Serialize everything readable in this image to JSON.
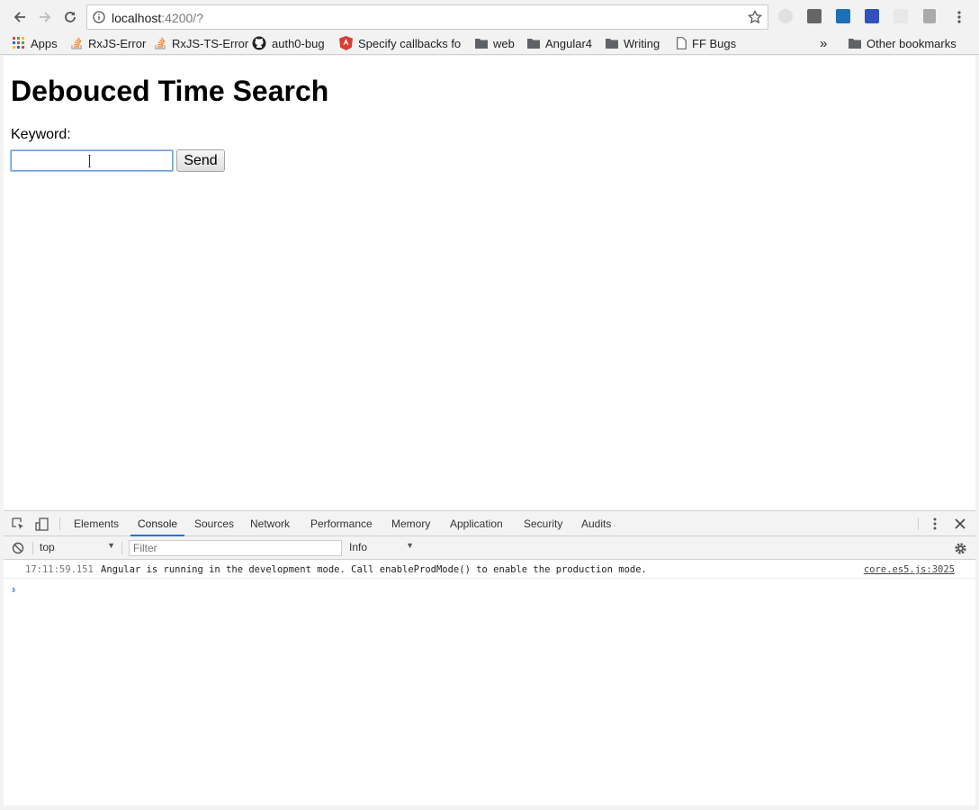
{
  "browser": {
    "url_host": "localhost",
    "url_rest": ":4200/?",
    "colors": {
      "accent": "#1a73e8"
    }
  },
  "bookmarks": {
    "items": [
      {
        "label": "Apps",
        "icon": "apps-grid-icon"
      },
      {
        "label": "RxJS-Error",
        "icon": "stackoverflow-icon"
      },
      {
        "label": "RxJS-TS-Error",
        "icon": "stackoverflow-icon"
      },
      {
        "label": "auth0-bug",
        "icon": "github-icon"
      },
      {
        "label": "Specify callbacks fo",
        "icon": "angular-shield-icon"
      },
      {
        "label": "web",
        "icon": "folder-icon"
      },
      {
        "label": "Angular4",
        "icon": "folder-icon"
      },
      {
        "label": "Writing",
        "icon": "folder-icon"
      },
      {
        "label": "FF Bugs",
        "icon": "page-icon"
      }
    ],
    "overflow_label": "»",
    "other_label": "Other bookmarks"
  },
  "page": {
    "title": "Debouced Time Search",
    "keyword_label": "Keyword:",
    "keyword_value": "",
    "send_label": "Send"
  },
  "devtools": {
    "tabs": [
      "Elements",
      "Console",
      "Sources",
      "Network",
      "Performance",
      "Memory",
      "Application",
      "Security",
      "Audits"
    ],
    "active_tab": "Console",
    "context": "top",
    "filter_placeholder": "Filter",
    "level": "Info",
    "log": {
      "timestamp": "17:11:59.151",
      "message": "Angular is running in the development mode. Call enableProdMode() to enable the production mode.",
      "source": "core.es5.js:3025"
    },
    "prompt": "›"
  }
}
